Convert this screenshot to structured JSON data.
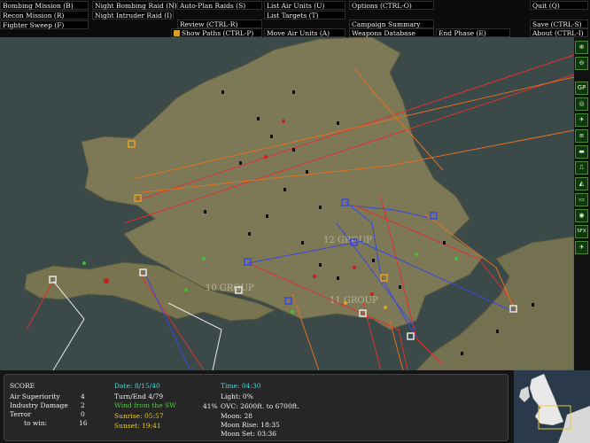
{
  "menu": {
    "bombing_mission": "Bombing Mission (B)",
    "recon_mission": "Recon Mission (R)",
    "fighter_sweep": "Fighter Sweep (F)",
    "night_bombing_raid": "Night Bombing Raid (N)",
    "night_intruder_raid": "Night Intruder Raid (I)",
    "auto_plan_raids": "Auto-Plan Raids (S)",
    "review": "Review (CTRL-R)",
    "show_paths": "Show Paths (CTRL-P)",
    "list_air_units": "List Air Units (U)",
    "list_targets": "List Targets (T)",
    "move_air_units": "Move Air Units (A)",
    "options": "Options (CTRL-O)",
    "campaign_summary": "Campaign Summary",
    "weapons_database": "Weapons Database",
    "end_phase": "End Phase (E)",
    "quit": "Quit (Q)",
    "save": "Save (CTRL-S)",
    "about": "About (CTRL-I)"
  },
  "map": {
    "labels": [
      "12 GROUP",
      "10 GROUP",
      "11 GROUP"
    ]
  },
  "toolbar": {
    "buttons": [
      "⊕",
      "⊖",
      "GP",
      "◎",
      "✈",
      "≡",
      "▬",
      "⎍",
      "◭",
      "▭",
      "◉",
      "SFX",
      "✈"
    ]
  },
  "score": {
    "title": "SCORE",
    "rows": [
      {
        "label": "Air Superiority",
        "value": "4"
      },
      {
        "label": "Industry Damage",
        "value": "2"
      },
      {
        "label": "Terror",
        "value": "0"
      },
      {
        "label": "to win:",
        "value": "16"
      }
    ]
  },
  "status": {
    "date": "Date: 8/15/40",
    "turn": "Turn/End  4/79",
    "wind": "Wind from the SW",
    "sunrise": "Sunrise: 05:57",
    "sunset": "Sunset: 19:41",
    "time": "Time: 04:30",
    "light": "Light: 0%",
    "cloud_pct": "41%",
    "cloud": "OVC: 2600ft. to 6700ft.",
    "moon": "Moon: 28",
    "moonrise": "Moon Rise: 18:35",
    "moonset": "Moon Set: 03:36"
  },
  "colors": {
    "sea": "#3a4848",
    "land": "#7e7a58",
    "cyan_text": "#48d8e0",
    "green_text": "#48d038",
    "yellow_text": "#e8c838"
  }
}
